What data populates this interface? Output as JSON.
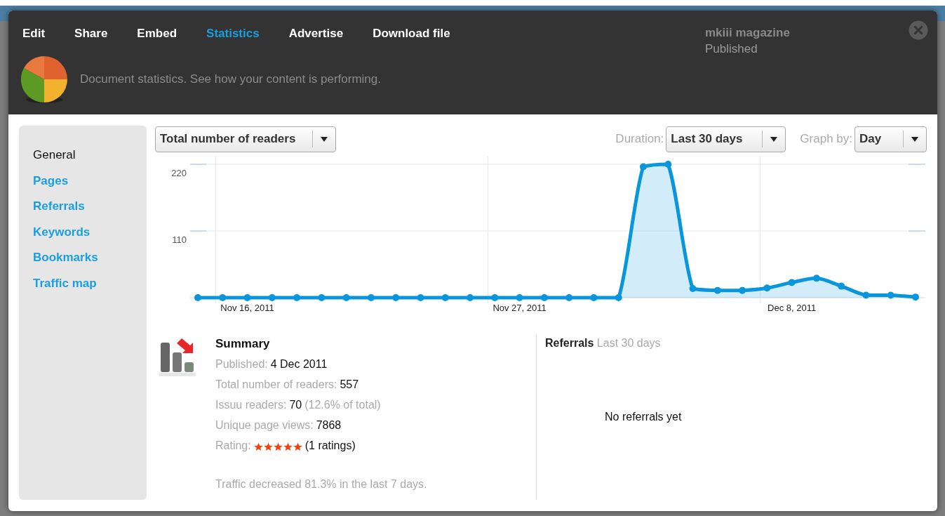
{
  "header": {
    "tabs": [
      {
        "label": "Edit",
        "selected": false
      },
      {
        "label": "Share",
        "selected": false
      },
      {
        "label": "Embed",
        "selected": false
      },
      {
        "label": "Statistics",
        "selected": true
      },
      {
        "label": "Advertise",
        "selected": false
      },
      {
        "label": "Download file",
        "selected": false
      }
    ],
    "document_title": "mkiii magazine",
    "document_status": "Published",
    "description": "Document statistics. See how your content is performing."
  },
  "sidebar": {
    "items": [
      {
        "label": "General",
        "selected": true
      },
      {
        "label": "Pages",
        "selected": false
      },
      {
        "label": "Referrals",
        "selected": false
      },
      {
        "label": "Keywords",
        "selected": false
      },
      {
        "label": "Bookmarks",
        "selected": false
      },
      {
        "label": "Traffic map",
        "selected": false
      }
    ]
  },
  "toolbar": {
    "metric": {
      "value": "Total number of readers"
    },
    "duration": {
      "label": "Duration:",
      "value": "Last 30 days"
    },
    "graph_by": {
      "label": "Graph by:",
      "value": "Day"
    }
  },
  "chart": {
    "chart_data": {
      "type": "area",
      "grid": true,
      "categories": [
        null,
        null,
        "Nov 16, 2011",
        null,
        null,
        null,
        null,
        null,
        null,
        null,
        null,
        null,
        null,
        "Nov 27, 2011",
        null,
        null,
        null,
        null,
        null,
        null,
        null,
        null,
        null,
        null,
        "Dec 8, 2011",
        null,
        null,
        null,
        null,
        null
      ],
      "series": [
        {
          "color": "#0a96dc",
          "values": [
            0,
            0,
            0,
            0,
            0,
            0,
            0,
            0,
            0,
            0,
            0,
            0,
            0,
            0,
            0,
            0,
            0,
            0,
            216,
            220,
            15,
            12,
            12,
            16,
            25,
            32,
            19,
            4,
            4,
            1
          ]
        }
      ],
      "ylim": [
        0,
        220
      ],
      "yticks": [
        110,
        220
      ]
    }
  },
  "summary": {
    "title": "Summary",
    "rows": [
      {
        "kind": "field",
        "label": "Published:",
        "value": "4 Dec 2011"
      },
      {
        "kind": "field",
        "label": "Total number of readers:",
        "value": "557"
      },
      {
        "kind": "field",
        "label": "Issuu readers:",
        "value": "70",
        "note": "(12.6% of total)"
      },
      {
        "kind": "field",
        "label": "Unique page views:",
        "value": "7868"
      },
      {
        "kind": "rating",
        "label": "Rating:",
        "stars": 5,
        "value": "(1 ratings)"
      }
    ],
    "trend": "Traffic decreased 81.3% in the last 7 days."
  },
  "referrals": {
    "title": "Referrals",
    "subtitle": "Last 30 days",
    "empty_message": "No referrals yet"
  }
}
